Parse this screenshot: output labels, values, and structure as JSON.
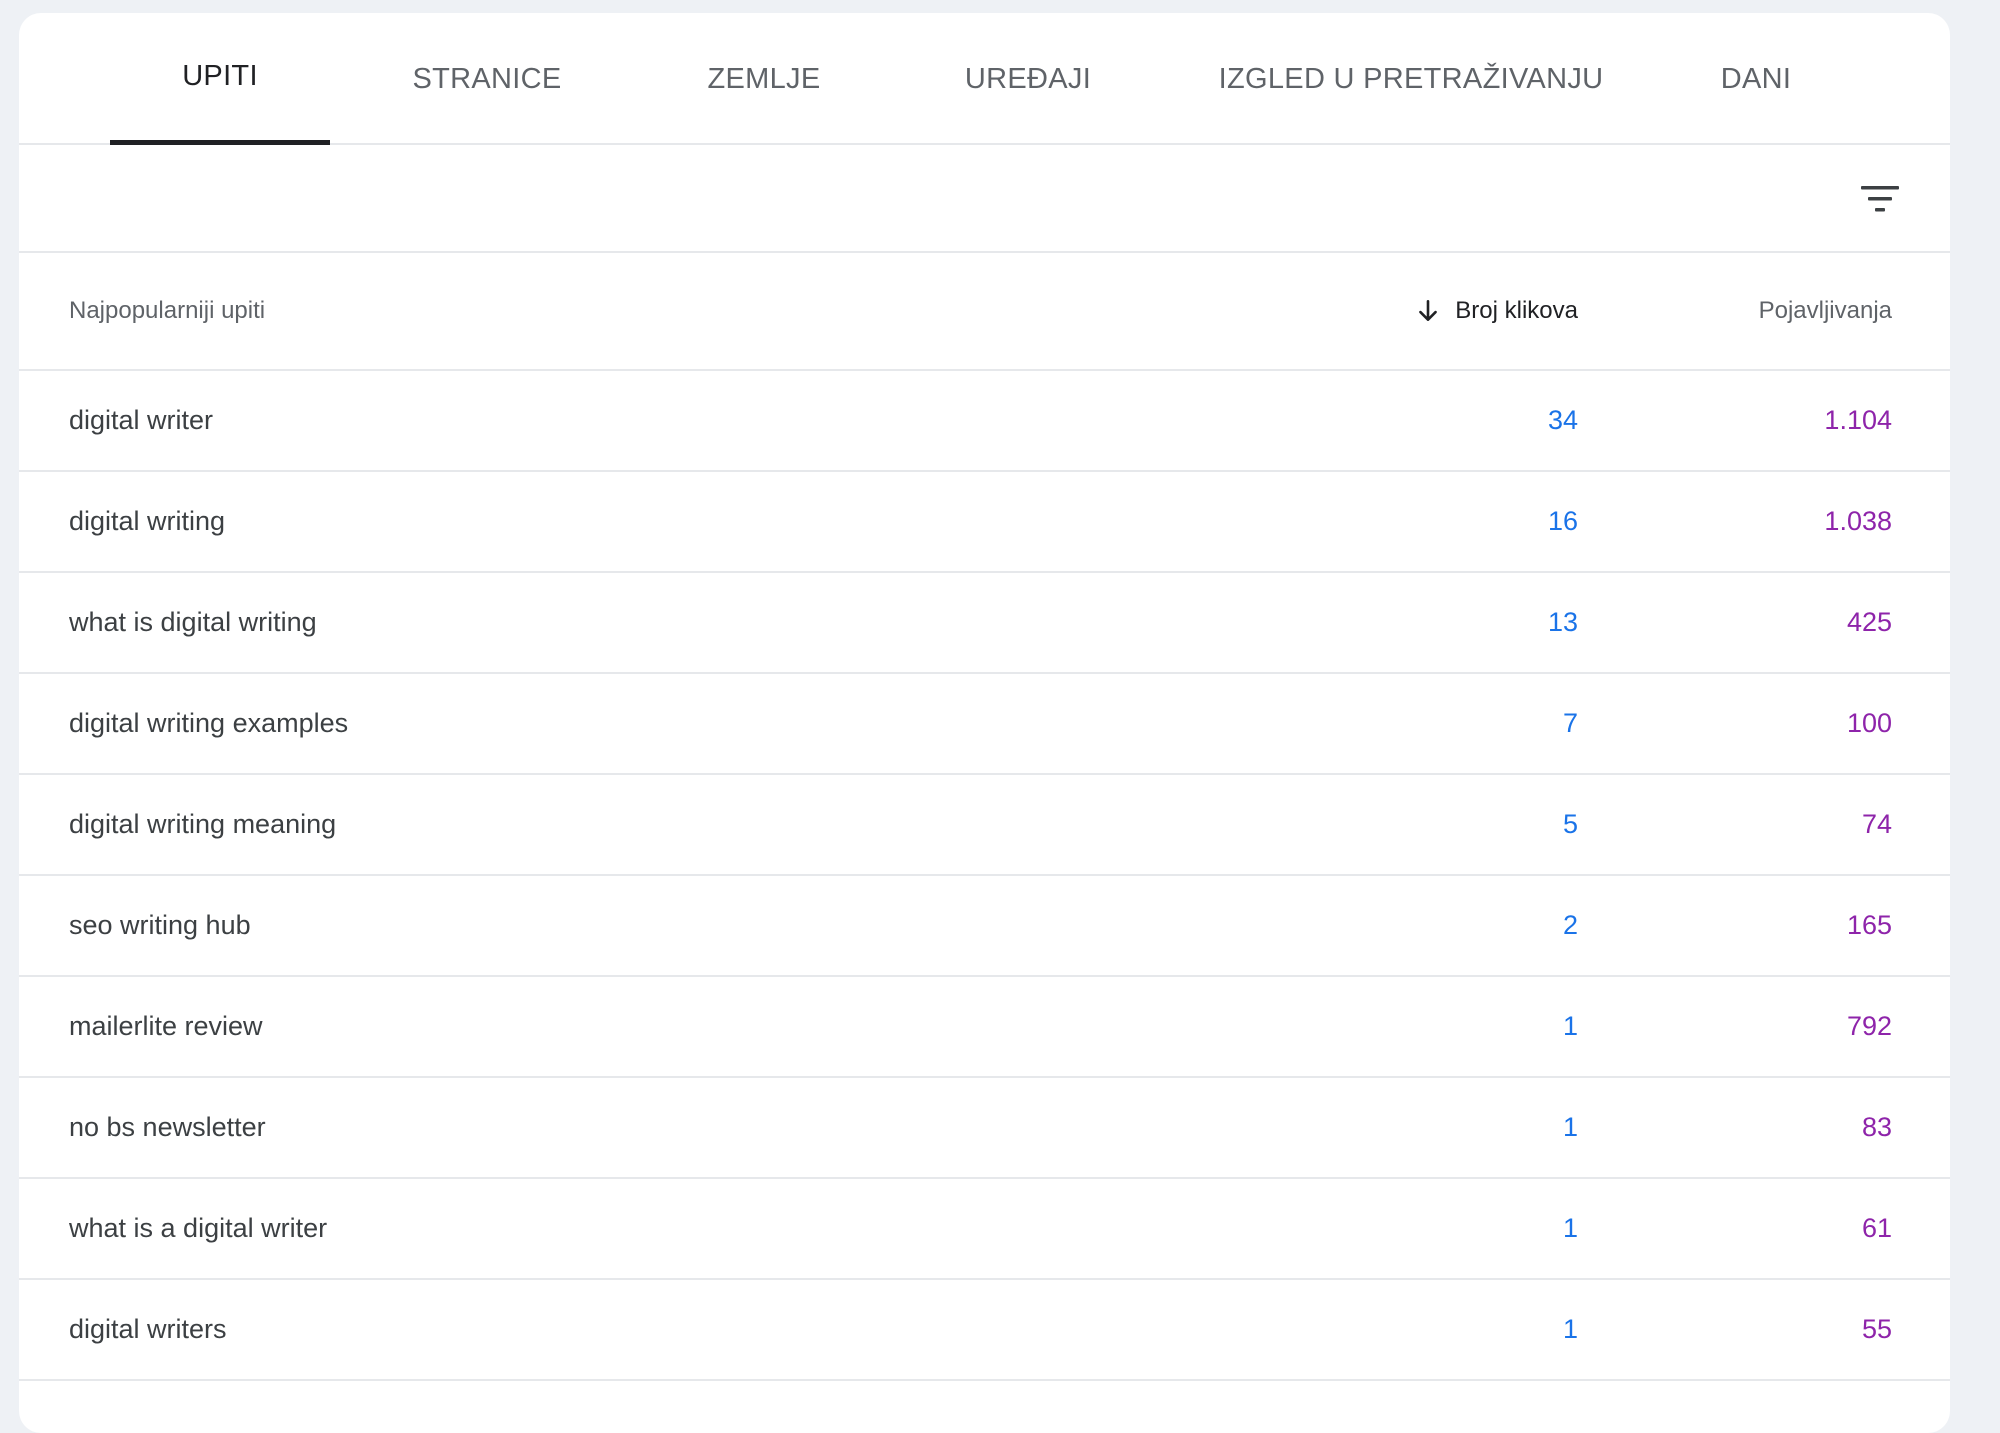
{
  "colors": {
    "clicks": "#1a73e8",
    "impressions": "#8e24aa",
    "active_tab": "#202124",
    "inactive_tab": "#5f6368",
    "page_background": "#eef1f5"
  },
  "tabs": [
    {
      "label": "UPITI",
      "active": true
    },
    {
      "label": "STRANICE",
      "active": false
    },
    {
      "label": "ZEMLJE",
      "active": false
    },
    {
      "label": "UREĐAJI",
      "active": false
    },
    {
      "label": "IZGLED U PRETRAŽIVANJU",
      "active": false
    },
    {
      "label": "DANI",
      "active": false
    }
  ],
  "toolbar": {
    "filter_icon": "filter-icon"
  },
  "table": {
    "headers": {
      "query": "Najpopularniji upiti",
      "clicks": "Broj klikova",
      "impressions": "Pojavljivanja"
    },
    "sort": {
      "column": "clicks",
      "direction": "descending",
      "icon": "arrow-down-icon"
    },
    "rows": [
      {
        "query": "digital writer",
        "clicks": "34",
        "impressions": "1.104"
      },
      {
        "query": "digital writing",
        "clicks": "16",
        "impressions": "1.038"
      },
      {
        "query": "what is digital writing",
        "clicks": "13",
        "impressions": "425"
      },
      {
        "query": "digital writing examples",
        "clicks": "7",
        "impressions": "100"
      },
      {
        "query": "digital writing meaning",
        "clicks": "5",
        "impressions": "74"
      },
      {
        "query": "seo writing hub",
        "clicks": "2",
        "impressions": "165"
      },
      {
        "query": "mailerlite review",
        "clicks": "1",
        "impressions": "792"
      },
      {
        "query": "no bs newsletter",
        "clicks": "1",
        "impressions": "83"
      },
      {
        "query": "what is a digital writer",
        "clicks": "1",
        "impressions": "61"
      },
      {
        "query": "digital writers",
        "clicks": "1",
        "impressions": "55"
      }
    ]
  }
}
